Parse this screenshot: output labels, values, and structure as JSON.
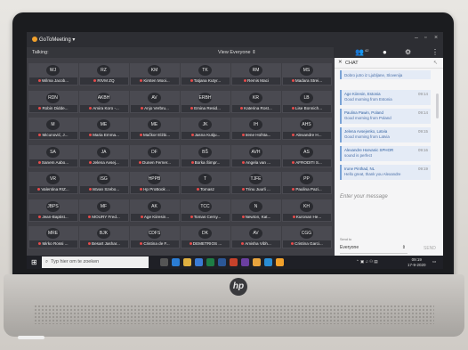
{
  "app": {
    "name": "GoToMeeting",
    "talking_label": "Talking:",
    "view_label": "View Everyone",
    "attendee_count": "42"
  },
  "attendees": [
    {
      "initials": "WJ",
      "name": "Wilma Jacob..."
    },
    {
      "initials": "RZ",
      "name": "RIVM ZQ"
    },
    {
      "initials": "KM",
      "name": "Kirsten Mooi..."
    },
    {
      "initials": "TK",
      "name": "Tatjana Kutyr..."
    },
    {
      "initials": "RM",
      "name": "Remis Maci"
    },
    {
      "initials": "MS",
      "name": "Madara Strei..."
    },
    {
      "initials": "RDN",
      "name": "Robin Didde..."
    },
    {
      "initials": "AKBH",
      "name": "Amira Koro -..."
    },
    {
      "initials": "AV",
      "name": "Anjo Verbru..."
    },
    {
      "initials": "ERBH",
      "name": "Emina Resid..."
    },
    {
      "initials": "KR",
      "name": "Katerina Rost..."
    },
    {
      "initials": "LB",
      "name": "Lise Bonnich..."
    },
    {
      "initials": "M",
      "name": "Micunović, J..."
    },
    {
      "initials": "ME",
      "name": "Maria Emma..."
    },
    {
      "initials": "ME",
      "name": "Mačkor Elżbi..."
    },
    {
      "initials": "JK",
      "name": "Jasna Kutiju..."
    },
    {
      "initials": "IH",
      "name": "Irene Hofsta..."
    },
    {
      "initials": "AHS",
      "name": "Alexandre H..."
    },
    {
      "initials": "SA",
      "name": "Sanem Aabo..."
    },
    {
      "initials": "JA",
      "name": "Jelena Avsej..."
    },
    {
      "initials": "DF",
      "name": "Dunen Ferner..."
    },
    {
      "initials": "BŠ",
      "name": "Borka Šimpr..."
    },
    {
      "initials": "AVH",
      "name": "Angela van ..."
    },
    {
      "initials": "AS",
      "name": "AFRODITI S..."
    },
    {
      "initials": "VR",
      "name": "Valentina RIZ..."
    },
    {
      "initials": "ISG",
      "name": "Istvan Szebo..."
    },
    {
      "initials": "HPPB",
      "name": "Hp ProBook ..."
    },
    {
      "initials": "T",
      "name": "Tomasz"
    },
    {
      "initials": "TJFE",
      "name": "Trinu Juurli ..."
    },
    {
      "initials": "PP",
      "name": "Paulina Pazi..."
    },
    {
      "initials": "JBPS",
      "name": "Jean-Baptist..."
    },
    {
      "initials": "MF",
      "name": "MOURY Fred..."
    },
    {
      "initials": "AK",
      "name": "Age Kiiresin..."
    },
    {
      "initials": "TCC",
      "name": "Tomas Cerny..."
    },
    {
      "initials": "N",
      "name": "Newton, Kat..."
    },
    {
      "initials": "KH",
      "name": "Kuronan He..."
    },
    {
      "initials": "MRE",
      "name": "Mirko Rossi ..."
    },
    {
      "initials": "BJK",
      "name": "Besart Jashar..."
    },
    {
      "initials": "CDFS",
      "name": "Cristina de F..."
    },
    {
      "initials": "DK",
      "name": "DEMETRIOS ..."
    },
    {
      "initials": "AV",
      "name": "Amisha Vibh..."
    },
    {
      "initials": "CGG",
      "name": "Cristina Garci..."
    }
  ],
  "chat": {
    "title": "CHAT",
    "messages": [
      {
        "from": "",
        "time": "",
        "body": "Dobro jutro iz Ljubljane, Slovenija"
      },
      {
        "from": "Age Kiiresin, Estonia",
        "time": "09:14",
        "body": "Good morning from Estonia"
      },
      {
        "from": "Paulina Pawin, Poland",
        "time": "09:14",
        "body": "Good morning from Poland"
      },
      {
        "from": "Jelena Avsejenko, Latvia",
        "time": "09:15",
        "body": "Good morning from Latvia"
      },
      {
        "from": "Alexandre Harvanic SPHOR",
        "time": "09:16",
        "body": "sound is perfect"
      },
      {
        "from": "Irune Pinthad, NL",
        "time": "09:19",
        "body": "Hello great, thank you Alexandre"
      }
    ],
    "input_placeholder": "Enter your message",
    "to_label": "Send to",
    "to_value": "Everyone",
    "send_label": "SEND"
  },
  "taskbar": {
    "search_placeholder": "Typ hier om te zoeken",
    "time": "09:19",
    "date": "17-9-2020"
  },
  "device": {
    "brand": "hp"
  }
}
